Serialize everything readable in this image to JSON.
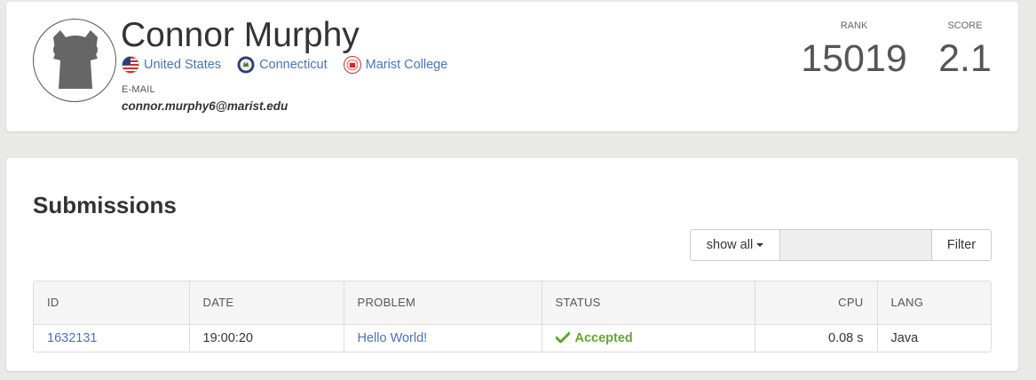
{
  "profile": {
    "name": "Connor Murphy",
    "affiliations": [
      {
        "label": "United States",
        "icon": "us-flag-icon"
      },
      {
        "label": "Connecticut",
        "icon": "connecticut-seal-icon"
      },
      {
        "label": "Marist College",
        "icon": "marist-college-logo-icon"
      }
    ],
    "email_label": "E-MAIL",
    "email": "connor.murphy6@marist.edu",
    "rank_label": "RANK",
    "rank": "15019",
    "score_label": "SCORE",
    "score": "2.1"
  },
  "submissions": {
    "title": "Submissions",
    "filter": {
      "show_all_label": "show all",
      "input_value": "",
      "input_placeholder": "",
      "filter_button_label": "Filter"
    },
    "columns": [
      "ID",
      "DATE",
      "PROBLEM",
      "STATUS",
      "CPU",
      "LANG"
    ],
    "rows": [
      {
        "id": "1632131",
        "date": "19:00:20",
        "problem": "Hello World!",
        "status": "Accepted",
        "cpu": "0.08 s",
        "lang": "Java"
      }
    ]
  },
  "colors": {
    "link": "#4a74b5",
    "accepted": "#5fa832",
    "background": "#e9e9e7"
  }
}
